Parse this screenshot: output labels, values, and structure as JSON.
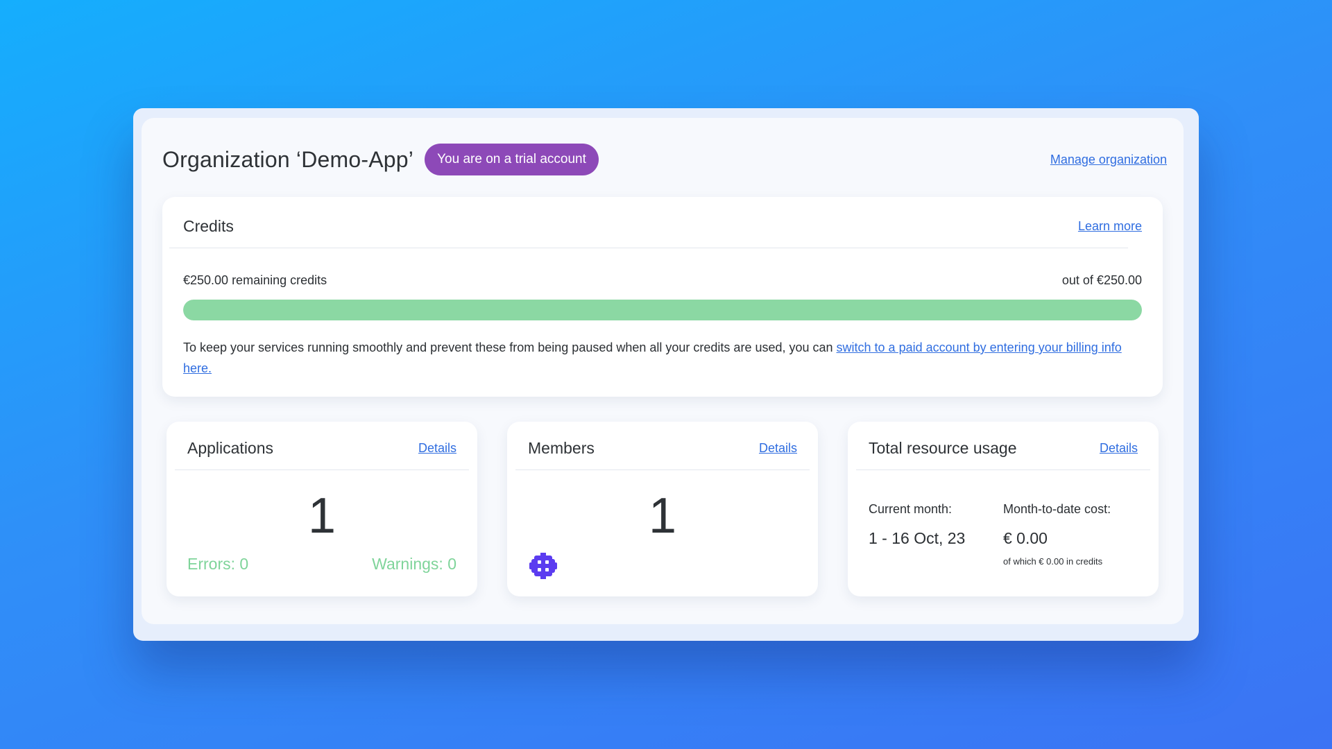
{
  "header": {
    "title": "Organization ‘Demo-App’",
    "trial_badge": "You are on a trial account",
    "manage_link": "Manage organization"
  },
  "credits": {
    "title": "Credits",
    "learn_more": "Learn more",
    "remaining": "€250.00 remaining credits",
    "out_of": "out of €250.00",
    "progress_fraction": 1.0,
    "progress_color": "#8bd8a3",
    "note_text": "To keep your services running smoothly and prevent these from being paused when all your credits are used, you can ",
    "note_link": "switch to a paid account by entering your billing info here."
  },
  "applications": {
    "title": "Applications",
    "details": "Details",
    "count": "1",
    "errors": "Errors: 0",
    "warnings": "Warnings: 0"
  },
  "members": {
    "title": "Members",
    "details": "Details",
    "count": "1",
    "avatar_icon": "robot-avatar-icon"
  },
  "usage": {
    "title": "Total resource usage",
    "details": "Details",
    "current_month_label": "Current month:",
    "current_month_value": "1 - 16 Oct, 23",
    "cost_label": "Month-to-date cost:",
    "cost_value": "€ 0.00",
    "cost_sub": "of which € 0.00 in credits"
  },
  "colors": {
    "accent_link": "#2f6de0",
    "trial_badge": "#8d49b8",
    "success_text": "#7fd49a",
    "avatar": "#5b3cf0"
  }
}
